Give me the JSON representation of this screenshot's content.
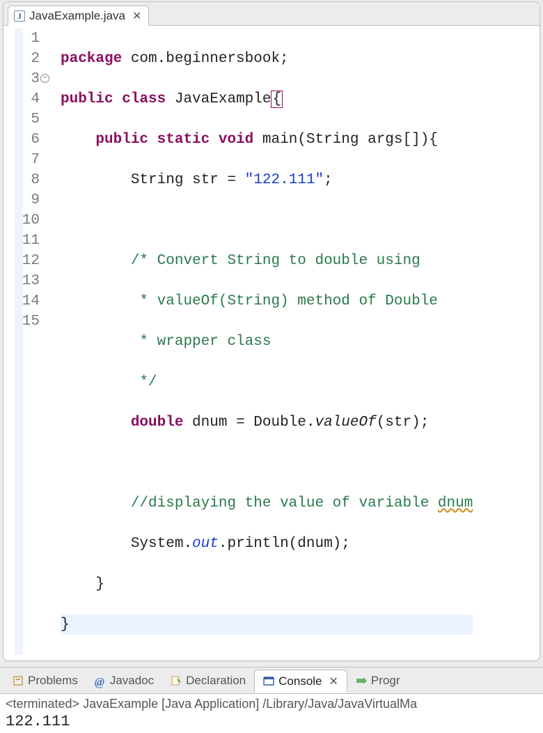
{
  "editor": {
    "tab": {
      "filename": "JavaExample.java",
      "close_glyph": "✕"
    },
    "lines": {
      "l1": {
        "n": "1"
      },
      "l2": {
        "n": "2"
      },
      "l3": {
        "n": "3"
      },
      "l4": {
        "n": "4"
      },
      "l5": {
        "n": "5"
      },
      "l6": {
        "n": "6"
      },
      "l7": {
        "n": "7"
      },
      "l8": {
        "n": "8"
      },
      "l9": {
        "n": "9"
      },
      "l10": {
        "n": "10"
      },
      "l11": {
        "n": "11"
      },
      "l12": {
        "n": "12"
      },
      "l13": {
        "n": "13"
      },
      "l14": {
        "n": "14"
      },
      "l15": {
        "n": "15"
      }
    },
    "code": {
      "kw_package": "package",
      "pkg_name": " com.beginnersbook;",
      "kw_public": "public",
      "kw_class": " class",
      "cls_name": " JavaExample",
      "brace_open": "{",
      "kw_static": " static",
      "kw_void": " void",
      "main_sig": " main(String args[]){",
      "indent2": "        ",
      "indent3": "            ",
      "str_decl_a": "String str = ",
      "str_lit": "\"122.111\"",
      "semi": ";",
      "cmt1": "/* Convert String to double using",
      "cmt2": " * valueOf(String) method of Double",
      "cmt3": " * wrapper class",
      "cmt4": " */",
      "kw_double": "double",
      "dnum_a": " dnum = Double.",
      "valueof": "valueOf",
      "dnum_b": "(str);",
      "cmt5a": "//displaying the value of variable ",
      "cmt5b": "dnum",
      "sys_a": "System.",
      "out": "out",
      "sys_b": ".println(dnum);",
      "brace_close2": "    }",
      "brace_close1": "}"
    }
  },
  "views": {
    "problems": "Problems",
    "javadoc": "Javadoc",
    "declaration": "Declaration",
    "console": "Console",
    "progress": "Progr"
  },
  "console": {
    "status": "<terminated> JavaExample [Java Application] /Library/Java/JavaVirtualMa",
    "output": "122.111"
  }
}
